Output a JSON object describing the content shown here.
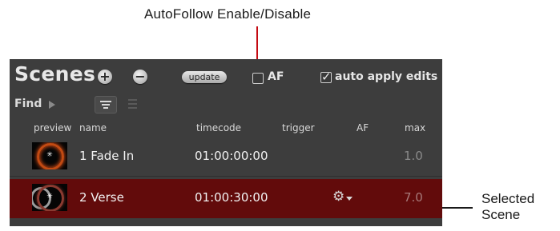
{
  "annotations": {
    "top_label": "AutoFollow Enable/Disable",
    "right_label_line1": "Selected",
    "right_label_line2": "Scene",
    "accent_color": "#c40a12"
  },
  "panel": {
    "title": "Scenes",
    "add_icon": "+",
    "remove_icon": "−",
    "update_label": "update",
    "af_checkbox": {
      "label": "AF",
      "checked": false
    },
    "auto_apply_checkbox": {
      "label": "auto apply edits",
      "checked": true,
      "mark": "✓"
    },
    "find_label": "Find",
    "columns": {
      "preview": "preview",
      "name": "name",
      "timecode": "timecode",
      "trigger": "trigger",
      "af": "AF",
      "max": "max"
    },
    "rows": [
      {
        "name": "1 Fade In",
        "timecode": "01:00:00:00",
        "trigger": "",
        "af": "",
        "max": "1.0",
        "selected": false,
        "thumb_icon": "✳"
      },
      {
        "name": "2 Verse",
        "timecode": "01:00:30:00",
        "trigger": "",
        "af_icon": "⚙",
        "max": "7.0",
        "selected": true,
        "thumb_icon": "✳"
      }
    ],
    "selected_color": "#620b0b"
  }
}
